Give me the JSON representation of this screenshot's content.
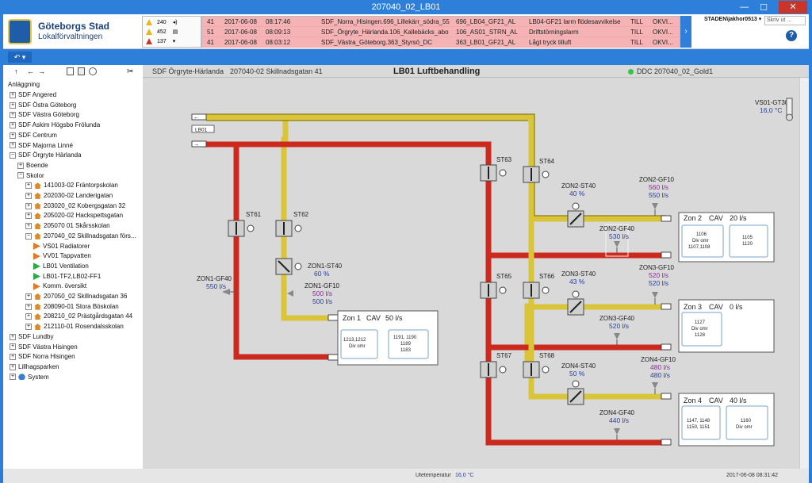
{
  "window": {
    "title": "207040_02_LB01",
    "minimize": "—",
    "maximize": "☐",
    "close": "✕"
  },
  "logo": {
    "line1": "Göteborgs Stad",
    "line2": "Lokalförvaltningen"
  },
  "alarm_counts": [
    {
      "icon": "warning-icon",
      "value": "240",
      "color": "#e8b51a"
    },
    {
      "icon": "warning-icon",
      "value": "452",
      "color": "#e8b51a"
    },
    {
      "icon": "error-icon",
      "value": "137",
      "color": "#c8352b"
    }
  ],
  "alarms": [
    {
      "count": "41",
      "date": "2017-06-08",
      "time": "08:17:46",
      "source": "SDF_Norra_Hisingen.696_Lillekärr_södra_55",
      "tag": "696_LB04_GF21_AL",
      "text": "LB04-GF21 larm flödesavvikelse",
      "state": "TILL",
      "ack": "OKVI..."
    },
    {
      "count": "51",
      "date": "2017-06-08",
      "time": "08:09:13",
      "source": "SDF_Örgryte_Härlanda.106_Kallebäcks_abo",
      "tag": "106_AS01_STRN_AL",
      "text": "Driftstörningslarm",
      "state": "TILL",
      "ack": "OKVI..."
    },
    {
      "count": "41",
      "date": "2017-06-08",
      "time": "08:03:12",
      "source": "SDF_Västra_Göteborg.363_Styrsö_DC",
      "tag": "363_LB01_GF21_AL",
      "text": "Lågt tryck tilluft",
      "state": "TILL",
      "ack": "OKVI..."
    }
  ],
  "user": {
    "name": "STADEN\\jakhor0513",
    "search_placeholder": "Skriv ut ...",
    "help": "?"
  },
  "menu": {
    "button": "↶ ▾"
  },
  "toolbar": {
    "up": "↑",
    "back": "←",
    "forward": "→"
  },
  "tree": {
    "root": "Anläggning",
    "items": [
      {
        "label": "SDF Angered",
        "level": 0,
        "kind": "box",
        "sign": "+"
      },
      {
        "label": "SDF Östra Göteborg",
        "level": 0,
        "kind": "box",
        "sign": "+"
      },
      {
        "label": "SDF Västra Göteborg",
        "level": 0,
        "kind": "box",
        "sign": "+"
      },
      {
        "label": "SDF Askim Högsbo Frölunda",
        "level": 0,
        "kind": "box",
        "sign": "+"
      },
      {
        "label": "SDF Centrum",
        "level": 0,
        "kind": "box",
        "sign": "+"
      },
      {
        "label": "SDF Majorna Linné",
        "level": 0,
        "kind": "box",
        "sign": "+"
      },
      {
        "label": "SDF Örgryte Härlanda",
        "level": 0,
        "kind": "box",
        "sign": "−"
      },
      {
        "label": "Boende",
        "level": 1,
        "kind": "box",
        "sign": "+"
      },
      {
        "label": "Skolor",
        "level": 1,
        "kind": "box",
        "sign": "−"
      },
      {
        "label": "141003-02 Fräntorpskolan",
        "level": 2,
        "kind": "house",
        "sign": "+"
      },
      {
        "label": "202030-02 Landerigatan",
        "level": 2,
        "kind": "house",
        "sign": "+"
      },
      {
        "label": "203020_02 Kobergsgatan 32",
        "level": 2,
        "kind": "house",
        "sign": "+"
      },
      {
        "label": "205020-02 Hackspettsgatan",
        "level": 2,
        "kind": "house",
        "sign": "+"
      },
      {
        "label": "205070 01 Skårsskolan",
        "level": 2,
        "kind": "house",
        "sign": "+"
      },
      {
        "label": "207040_02 Skillnadsgatan förs...",
        "level": 2,
        "kind": "house",
        "sign": "−"
      },
      {
        "label": "VS01 Radiatorer",
        "level": 3,
        "kind": "flag",
        "color": "#e07a2a"
      },
      {
        "label": "VV01 Tappvatten",
        "level": 3,
        "kind": "flag",
        "color": "#e07a2a"
      },
      {
        "label": "LB01 Ventilation",
        "level": 3,
        "kind": "flag",
        "color": "#2fa84a"
      },
      {
        "label": "LB01-TF2,LB02-FF1",
        "level": 3,
        "kind": "flag",
        "color": "#2fa84a"
      },
      {
        "label": "Komm. översikt",
        "level": 3,
        "kind": "flag",
        "color": "#e07a2a"
      },
      {
        "label": "207050_02 Skillnadsgatan 36",
        "level": 2,
        "kind": "house",
        "sign": "+"
      },
      {
        "label": "208090-01 Stora Böskolan",
        "level": 2,
        "kind": "house",
        "sign": "+"
      },
      {
        "label": "208210_02 Prästgårdsgatan 44",
        "level": 2,
        "kind": "house",
        "sign": "+"
      },
      {
        "label": "212110-01 Rosendalsskolan",
        "level": 2,
        "kind": "house",
        "sign": "+"
      },
      {
        "label": "SDF Lundby",
        "level": 0,
        "kind": "box",
        "sign": "+"
      },
      {
        "label": "SDF Västra Hisingen",
        "level": 0,
        "kind": "box",
        "sign": "+"
      },
      {
        "label": "SDF Norra Hisingen",
        "level": 0,
        "kind": "box",
        "sign": "+"
      },
      {
        "label": "Lillhagsparken",
        "level": 0,
        "kind": "box",
        "sign": "+"
      },
      {
        "label": "System",
        "level": 0,
        "kind": "sys",
        "sign": "+"
      }
    ]
  },
  "header": {
    "district": "SDF Örgryte-Härlanda",
    "address": "207040-02 Skillnadsgatan 41",
    "title": "LB01 Luftbehandling",
    "ddc": "DDC 207040_02_Gold1"
  },
  "colors": {
    "supply": "#d9c43a",
    "exhaust": "#cc2a1e",
    "flow": "#8a2a9a",
    "value": "#2a3f9a"
  },
  "schematic": {
    "lb01": "LB01",
    "vs01_tag": "VS01-GT30",
    "vs01_value": "16,0 °C",
    "st61": "ST61",
    "st62": "ST62",
    "st63": "ST63",
    "st64": "ST64",
    "st65": "ST65",
    "st66": "ST66",
    "st67": "ST67",
    "st68": "ST68",
    "zon1_gf40": "ZON1-GF40",
    "zon1_gf40_val": "550 l/s",
    "zon1_st40": "ZON1-ST40",
    "zon1_st40_val": "60 %",
    "zon1_gf10": "ZON1-GF10",
    "zon1_gf10_a": "500 l/s",
    "zon1_gf10_b": "500 l/s",
    "zon2_st40": "ZON2-ST40",
    "zon2_st40_val": "40 %",
    "zon2_gf10": "ZON2-GF10",
    "zon2_gf10_a": "560 l/s",
    "zon2_gf10_b": "550 l/s",
    "zon2_gf40": "ZON2-GF40",
    "zon2_gf40_val": "530 l/s",
    "zon3_st40": "ZON3-ST40",
    "zon3_st40_val": "43 %",
    "zon3_gf10": "ZON3-GF10",
    "zon3_gf10_a": "520 l/s",
    "zon3_gf10_b": "520 l/s",
    "zon3_gf40": "ZON3-GF40",
    "zon3_gf40_val": "520 l/s",
    "zon4_st40": "ZON4-ST40",
    "zon4_st40_val": "50 %",
    "zon4_gf10": "ZON4-GF10",
    "zon4_gf10_a": "480 l/s",
    "zon4_gf10_b": "480 l/s",
    "zon4_gf40": "ZON4-GF40",
    "zon4_gf40_val": "440 l/s",
    "zone1": {
      "title": "Zon 1",
      "mode": "CAV",
      "flow": "50 l/s",
      "room_a1": "1213,1212",
      "room_a2": "Div omr",
      "room_b1": "1191, 1190",
      "room_b2": "1189",
      "room_b3": "1183"
    },
    "zone2": {
      "title": "Zon 2",
      "mode": "CAV",
      "flow": "20 l/s",
      "room_a1": "1106",
      "room_a2": "Div omr",
      "room_a3": "1107,1108",
      "room_b1": "1105",
      "room_b2": "1120"
    },
    "zone3": {
      "title": "Zon 3",
      "mode": "CAV",
      "flow": "0 l/s",
      "room_a1": "1127",
      "room_a2": "Div omr",
      "room_a3": "1128"
    },
    "zone4": {
      "title": "Zon 4",
      "mode": "CAV",
      "flow": "40 l/s",
      "room_a1": "1147, 1148",
      "room_a2": "1150, 1151",
      "room_b1": "1160",
      "room_b2": "Div omr"
    }
  },
  "status": {
    "outdoor_label": "Utetemperatur",
    "outdoor_value": "16,0 °C",
    "timestamp": "2017-06-08 08:31:42"
  }
}
